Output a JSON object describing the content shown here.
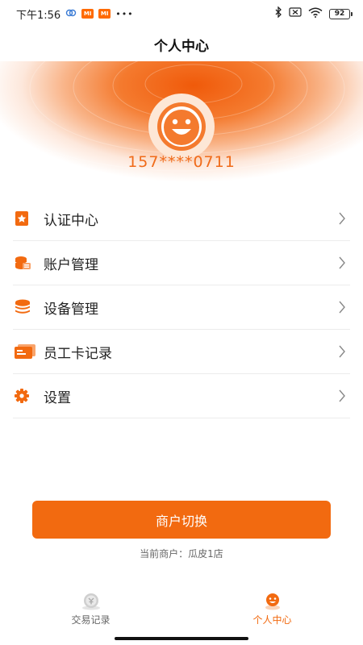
{
  "status_bar": {
    "time": "下午1:56",
    "mi_badge_1": "MI",
    "mi_badge_2": "MI",
    "more": "•••",
    "battery": "92"
  },
  "header": {
    "title": "个人中心"
  },
  "profile": {
    "phone": "157****0711"
  },
  "menu": {
    "items": [
      {
        "label": "认证中心",
        "icon": "certification-star-icon"
      },
      {
        "label": "账户管理",
        "icon": "account-coins-icon"
      },
      {
        "label": "设备管理",
        "icon": "device-stack-icon"
      },
      {
        "label": "员工卡记录",
        "icon": "employee-card-icon"
      },
      {
        "label": "设置",
        "icon": "gear-icon"
      }
    ]
  },
  "actions": {
    "switch_merchant": "商户切换"
  },
  "merchant": {
    "current": "当前商户：瓜皮1店"
  },
  "bottom_nav": {
    "tabs": [
      {
        "label": "交易记录",
        "active": false
      },
      {
        "label": "个人中心",
        "active": true
      }
    ]
  },
  "colors": {
    "accent": "#f26a10",
    "text": "#222222",
    "muted": "#666666"
  }
}
